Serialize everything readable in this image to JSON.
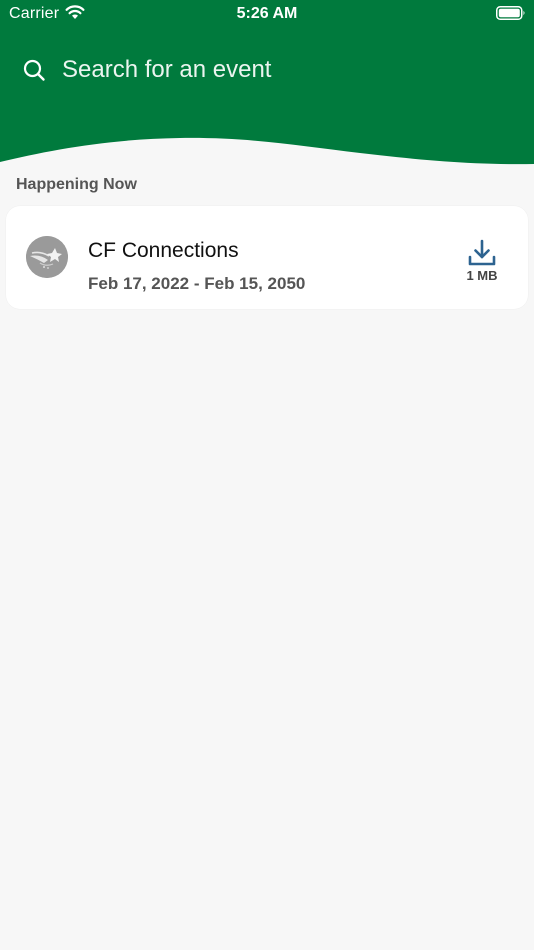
{
  "colors": {
    "header_green": "#007a3d",
    "background": "#f7f7f7",
    "card": "#ffffff",
    "download_icon": "#2d6390"
  },
  "status_bar": {
    "carrier": "Carrier",
    "time": "5:26 AM",
    "wifi_icon": "wifi-icon",
    "battery_icon": "battery-icon"
  },
  "search": {
    "placeholder": "Search for an event",
    "icon": "search-icon"
  },
  "section": {
    "title": "Happening Now"
  },
  "events": [
    {
      "name": "CF Connections",
      "dates": "Feb 17, 2022 - Feb 15, 2050",
      "download_size": "1 MB",
      "download_icon": "download-icon",
      "logo_icon": "shooting-star-logo-icon"
    }
  ]
}
